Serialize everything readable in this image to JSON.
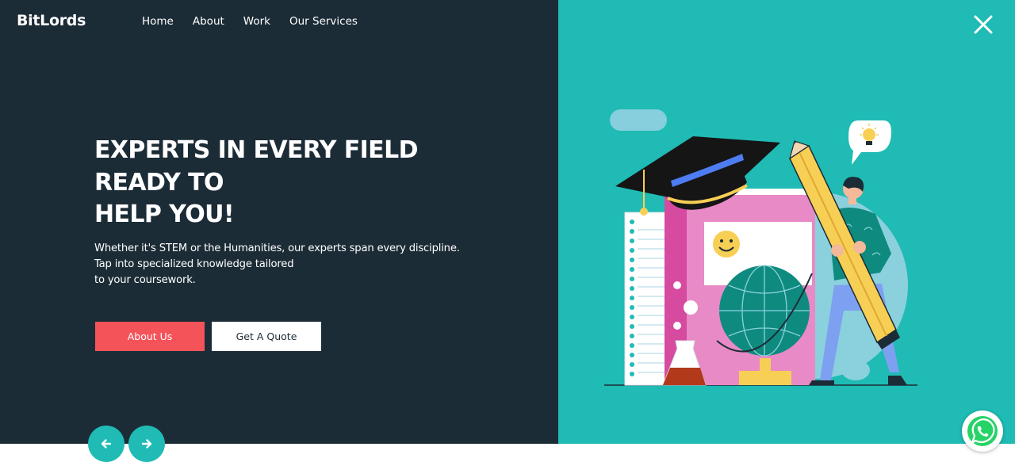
{
  "brand": {
    "logo_text": "BitLords"
  },
  "nav": {
    "items": [
      {
        "label": "Home"
      },
      {
        "label": "About"
      },
      {
        "label": "Work"
      },
      {
        "label": "Our Services"
      }
    ]
  },
  "hero": {
    "title_lines": [
      "EXPERTS IN EVERY FIELD",
      "READY TO",
      "HELP YOU!"
    ],
    "description_lines": [
      "Whether it's STEM or the Humanities, our experts span every discipline.",
      "Tap into specialized knowledge tailored",
      "to your coursework."
    ],
    "primary_button": "About Us",
    "secondary_button": "Get A Quote"
  },
  "icons": {
    "close": "close-icon",
    "prev": "arrow-left-icon",
    "next": "arrow-right-icon",
    "chat": "whatsapp-icon"
  },
  "colors": {
    "left_background": "#1c2c37",
    "right_background": "#1fbbb4",
    "primary_button": "#f4535a",
    "accent": "#1fbbb4"
  }
}
